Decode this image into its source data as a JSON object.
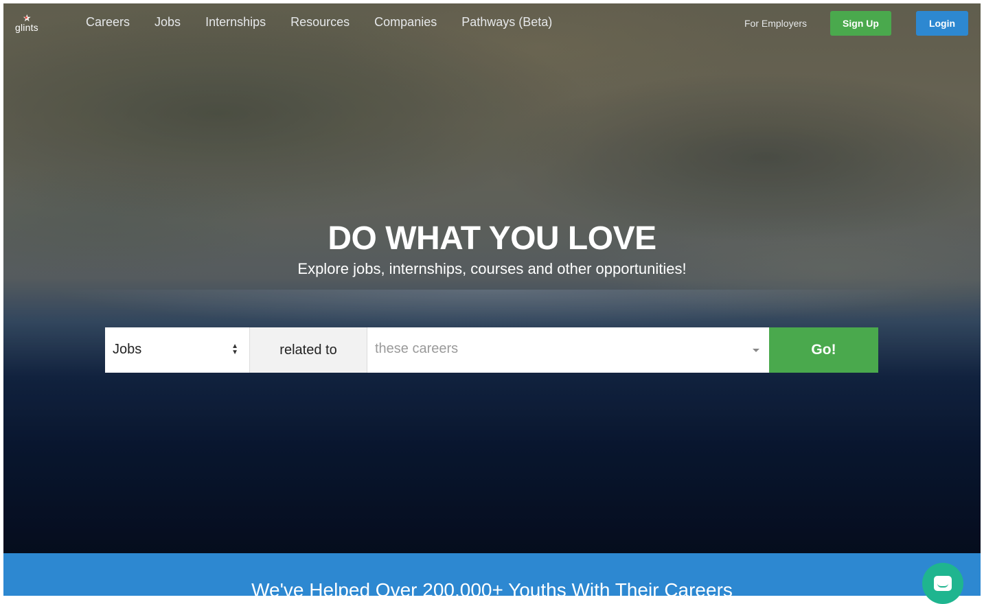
{
  "brand": {
    "logo_text": "glints"
  },
  "nav": {
    "links": [
      "Careers",
      "Jobs",
      "Internships",
      "Resources",
      "Companies",
      "Pathways (Beta)"
    ],
    "for_employers": "For Employers",
    "signup_label": "Sign Up",
    "login_label": "Login"
  },
  "hero": {
    "headline": "DO WHAT YOU LOVE",
    "subheadline": "Explore jobs, internships, courses and other opportunities!"
  },
  "search": {
    "type_value": "Jobs",
    "related_label": "related to",
    "careers_placeholder": "these careers",
    "go_label": "Go!"
  },
  "band": {
    "text": "We've Helped Over 200,000+ Youths With Their Careers"
  },
  "colors": {
    "green": "#4aa94d",
    "blue": "#2d88d1",
    "chat": "#1fb58f"
  },
  "icons": {
    "logo": "star-icon",
    "select": "updown-arrows-icon",
    "dropdown": "caret-down-icon",
    "chat": "chat-icon"
  }
}
